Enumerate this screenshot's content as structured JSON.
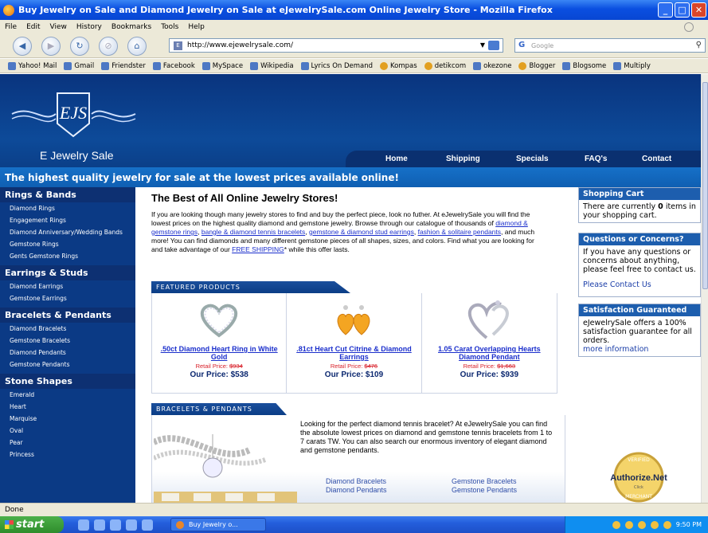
{
  "window": {
    "title": "Buy Jewelry on Sale and Diamond Jewelry on Sale at eJewelrySale.com Online Jewelry Store - Mozilla Firefox"
  },
  "menu": [
    "File",
    "Edit",
    "View",
    "History",
    "Bookmarks",
    "Tools",
    "Help"
  ],
  "address": {
    "url": "http://www.ejewelrysale.com/"
  },
  "search": {
    "placeholder": "Google"
  },
  "bookmarks": [
    "Yahoo! Mail",
    "Gmail",
    "Friendster",
    "Facebook",
    "MySpace",
    "Wikipedia",
    "Lyrics On Demand",
    "Kompas",
    "detikcom",
    "okezone",
    "Blogger",
    "Blogsome",
    "Multiply"
  ],
  "site": {
    "logo_text": "EJS",
    "name": "E Jewelry Sale",
    "nav": [
      "Home",
      "Shipping",
      "Specials",
      "FAQ's",
      "Contact"
    ],
    "banner": "The highest quality jewelry for sale at the lowest prices available online!"
  },
  "leftnav": {
    "rings": {
      "title": "Rings & Bands",
      "items": [
        "Diamond Rings",
        "Engagement Rings",
        "Diamond Anniversary/Wedding Bands",
        "Gemstone Rings",
        "Gents Gemstone Rings"
      ]
    },
    "earrings": {
      "title": "Earrings & Studs",
      "items": [
        "Diamond Earrings",
        "Gemstone Earrings"
      ]
    },
    "bracelets": {
      "title": "Bracelets & Pendants",
      "items": [
        "Diamond Bracelets",
        "Gemstone Bracelets",
        "Diamond Pendants",
        "Gemstone Pendants"
      ]
    },
    "shapes": {
      "title": "Stone Shapes",
      "items": [
        "Emerald",
        "Heart",
        "Marquise",
        "Oval",
        "Pear",
        "Princess"
      ]
    }
  },
  "main": {
    "heading": "The Best of All Online Jewelry Stores!",
    "intro": {
      "p1": "If you are looking though many jewelry stores to find and buy the perfect piece, look no futher. At eJewelrySale you will find the lowest prices on the highest quality diamond and gemstone jewelry. Browse through our catalogue of thousands of ",
      "l1": "diamond & gemstone rings",
      "s1": ", ",
      "l2": "bangle & diamond tennis bracelets",
      "s2": ", ",
      "l3": "gemstone & diamond stud earrings",
      "s3": ", ",
      "l4": "fashion & solitaire pendants",
      "p2": ", and much more! You can find diamonds and many different gemstone pieces of all shapes, sizes, and colors. Find what you are looking for and take advantage of our ",
      "l5": "FREE SHIPPING",
      "p3": "* while this offer lasts."
    },
    "featured_title": "FEATURED PRODUCTS",
    "products": [
      {
        "name": ".50ct Diamond Heart Ring in White Gold",
        "retail_label": "Retail Price: ",
        "retail": "$934",
        "price": "Our Price: $538"
      },
      {
        "name": ".81ct Heart Cut Citrine & Diamond Earrings",
        "retail_label": "Retail Price: ",
        "retail": "$476",
        "price": "Our Price: $109"
      },
      {
        "name": "1.05 Carat Overlapping Hearts Diamond Pendant",
        "retail_label": "Retail Price: ",
        "retail": "$1,663",
        "price": "Our Price: $939"
      }
    ],
    "bracelets_title": "BRACELETS & PENDANTS",
    "bracelets_text": "Looking for the perfect diamond tennis bracelet? At eJewelrySale you can find the absolute lowest prices on diamond and gemstone tennis bracelets from 1 to 7 carats TW. You can also search our enormous inventory of elegant diamond and gemstone pendants.",
    "bracelet_links": [
      "Diamond Bracelets",
      "Diamond Pendants",
      "Gemstone Bracelets",
      "Gemstone Pendants"
    ]
  },
  "sidebar": {
    "cart_title": "Shopping Cart",
    "cart_text1": "There are currently ",
    "cart_count": "0",
    "cart_text2": " items in your shopping cart.",
    "questions_title": "Questions or Concerns?",
    "questions_text": "If you have any questions or concerns about anything, please feel free to contact us.",
    "contact_link": "Please Contact Us",
    "guarantee_title": "Satisfaction Guaranteed",
    "guarantee_text": "eJewelrySale offers a 100% satisfaction guarantee for all orders.",
    "more_link": "more information",
    "seal_top": "VERIFIED",
    "seal_name": "Authorize.Net",
    "seal_click": "Click",
    "seal_bottom": "MERCHANT"
  },
  "status": {
    "text": "Done"
  },
  "taskbar": {
    "start": "start",
    "task": "Buy Jewelry o...",
    "clock": "9:50 PM"
  },
  "colors": {
    "header": "#0b3f88",
    "banner": "#1670c8",
    "leftnav": "#0b3a85",
    "link": "#1b2fcc",
    "retail": "#d8202a"
  }
}
